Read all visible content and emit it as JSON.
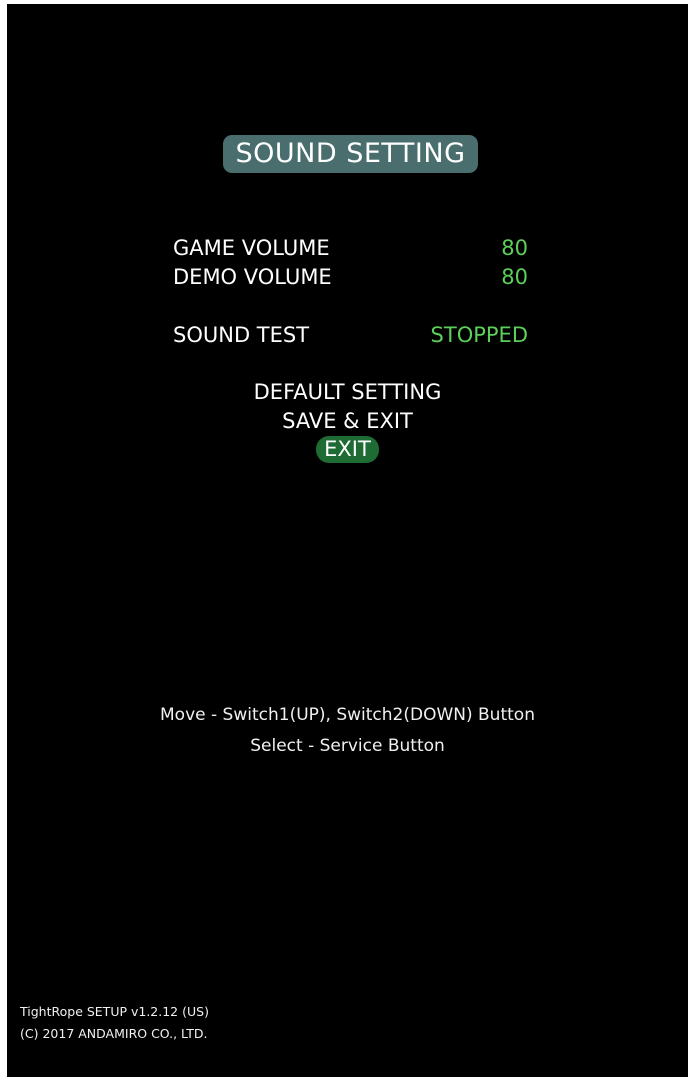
{
  "title": "SOUND SETTING",
  "settings": [
    {
      "label": "GAME VOLUME",
      "value": "80"
    },
    {
      "label": "DEMO VOLUME",
      "value": "80"
    },
    {
      "label": "SOUND TEST",
      "value": "STOPPED"
    }
  ],
  "menu": {
    "default_setting": "DEFAULT SETTING",
    "save_exit": "SAVE & EXIT",
    "exit": "EXIT",
    "selected": "EXIT"
  },
  "help": {
    "move": "Move - Switch1(UP), Switch2(DOWN) Button",
    "select": "Select - Service Button"
  },
  "footer": {
    "version": "TightRope SETUP v1.2.12 (US)",
    "copyright": "(C) 2017 ANDAMIRO CO., LTD."
  },
  "colors": {
    "background": "#000000",
    "title_pill": "#4a6e6e",
    "value_green": "#5ccf5a",
    "selected_pill": "#1f6b34",
    "text": "#ffffff"
  }
}
